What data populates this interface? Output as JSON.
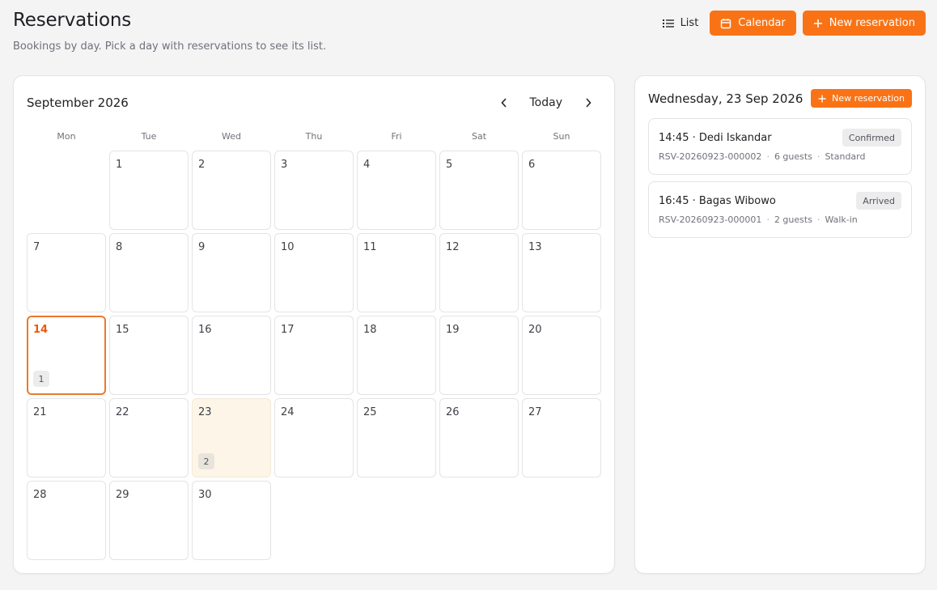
{
  "header": {
    "title": "Reservations",
    "subtitle": "Bookings by day. Pick a day with reservations to see its list."
  },
  "toolbar": {
    "list_label": "List",
    "calendar_label": "Calendar",
    "new_reservation_label": "New reservation"
  },
  "calendar": {
    "month_label": "September 2026",
    "today_label": "Today",
    "weekdays": [
      "Mon",
      "Tue",
      "Wed",
      "Thu",
      "Fri",
      "Sat",
      "Sun"
    ],
    "leading_blank_days": 1,
    "days_in_month": 30,
    "today": 14,
    "selected": 23,
    "counts": {
      "14": "1",
      "23": "2"
    }
  },
  "side": {
    "date_label": "Wednesday, 23 Sep 2026",
    "new_reservation_label": "New reservation",
    "reservations": [
      {
        "title": "14:45 · Dedi Iskandar",
        "code": "RSV-20260923-000002",
        "guests": "6 guests",
        "type": "Standard",
        "status": "Confirmed"
      },
      {
        "title": "16:45 · Bagas Wibowo",
        "code": "RSV-20260923-000001",
        "guests": "2 guests",
        "type": "Walk-in",
        "status": "Arrived"
      }
    ]
  },
  "colors": {
    "accent": "#f97316",
    "today_border": "#ea7a2c",
    "selected_bg": "#fdf5e8"
  },
  "icons": {
    "list": "list-icon",
    "calendar": "calendar-icon",
    "plus": "plus-icon",
    "prev": "chevron-left-icon",
    "next": "chevron-right-icon"
  }
}
